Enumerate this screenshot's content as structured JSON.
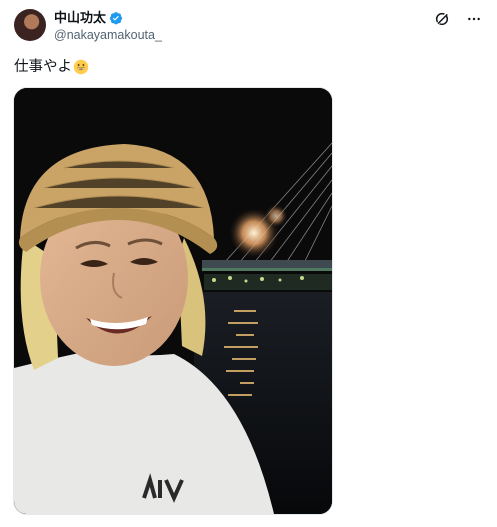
{
  "post": {
    "author": {
      "display_name": "中山功太",
      "handle": "@nakayamakouta_",
      "verified": true
    },
    "text": "仕事やよ",
    "emoji": "grinning-face-emoji",
    "icons": [
      "grok-icon",
      "more-options-icon"
    ],
    "media": {
      "type": "photo",
      "description_icons": [
        "selfie-photo"
      ]
    }
  },
  "colors": {
    "text": "#0f1419",
    "secondary_text": "#536471",
    "verified_blue": "#1d9bf0"
  }
}
